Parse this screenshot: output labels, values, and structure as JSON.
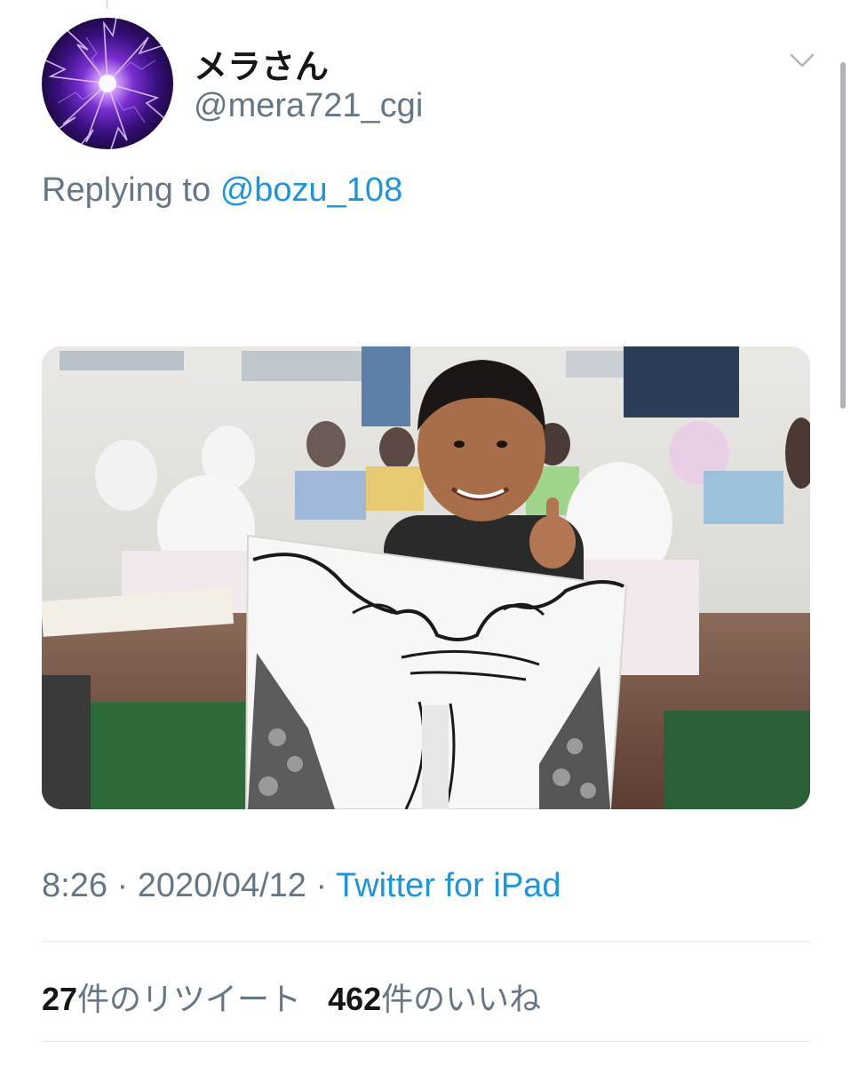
{
  "tweet": {
    "user": {
      "display_name": "メラさん",
      "handle": "@mera721_cgi",
      "avatar_icon": "lightning-avatar"
    },
    "reply": {
      "prefix": "Replying to",
      "to_handle": "@bozu_108"
    },
    "media": {
      "icon": "photo-child-holding-drawing"
    },
    "meta": {
      "time": "8:26",
      "separator": " · ",
      "date": "2020/04/12",
      "source": "Twitter for iPad"
    },
    "stats": {
      "retweets_count": "27",
      "retweets_label": "件のリツイート",
      "likes_count": "462",
      "likes_label": "件のいいね"
    }
  },
  "colors": {
    "link": "#1b95e0",
    "secondary_text": "#657786",
    "primary_text": "#14171a",
    "divider": "#e1e8ed"
  }
}
